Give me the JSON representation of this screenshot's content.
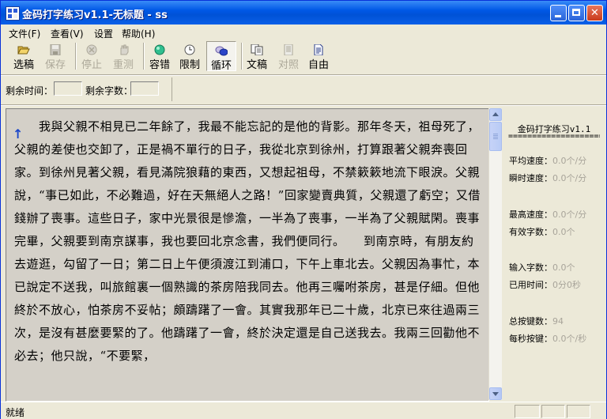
{
  "window": {
    "title": "金码打字练习v1.1-无标题 - ss"
  },
  "menu": [
    "文件(F)",
    "查看(V)",
    "设置",
    "帮助(H)"
  ],
  "toolbar": {
    "select": "选稿",
    "save": "保存",
    "stop": "停止",
    "retest": "重测",
    "tolerance": "容错",
    "limit": "限制",
    "loop": "循环",
    "article": "文稿",
    "compare": "对照",
    "free": "自由"
  },
  "info": {
    "remaining_time_label": "剩余时间：",
    "remaining_chars_label": "剩余字数："
  },
  "text": {
    "cursor": "↑",
    "content": "　　我與父親不相見已二年餘了，我最不能忘記的是他的背影。那年冬天，祖母死了，父親的差使也交卸了，正是禍不單行的日子，我從北京到徐州，打算跟著父親奔喪回家。到徐州見著父親，看見滿院狼藉的東西，又想起祖母，不禁簌簌地流下眼淚。父親說，“事已如此，不必難過，好在天無絕人之路！”回家變賣典質，父親還了虧空；又借錢辦了喪事。這些日子，家中光景很是慘澹，一半為了喪事，一半為了父親賦閑。喪事完畢，父親要到南京謀事，我也要回北京念書，我們便同行。　　到南京時，有朋友約去遊逛，勾留了一日；第二日上午便須渡江到浦口，下午上車北去。父親因為事忙，本已說定不送我，叫旅館裏一個熟識的茶房陪我同去。他再三囑咐茶房，甚是仔細。但他終於不放心，怕茶房不妥帖；頗躊躇了一會。其實我那年已二十歲，北京已來往過兩三次，是沒有甚麼要緊的了。他躊躇了一會，終於決定還是自己送我去。我兩三回勸他不必去；他只說，“不要緊，"
  },
  "stats": {
    "title": "金码打字练习v1.1",
    "rule": "====================",
    "avg_speed_label": "平均速度：",
    "avg_speed": "0.0个/分",
    "inst_speed_label": "瞬时速度：",
    "inst_speed": "0.0个/分",
    "max_speed_label": "最高速度：",
    "max_speed": "0.0个/分",
    "valid_chars_label": "有效字数：",
    "valid_chars": "0.0个",
    "input_chars_label": "输入字数：",
    "input_chars": "0.0个",
    "time_used_label": "已用时间：",
    "time_used": "0分0秒",
    "total_keys_label": "总按键数：",
    "total_keys": "94",
    "keys_per_sec_label": "每秒按键：",
    "keys_per_sec": "0.0个/秒"
  },
  "status": {
    "text": "就绪"
  },
  "colors": {
    "title_bar": "#0058e6",
    "text_bg": "#d4d0c8",
    "cursor": "#1a46c9",
    "stat_value": "#a8a49a"
  }
}
